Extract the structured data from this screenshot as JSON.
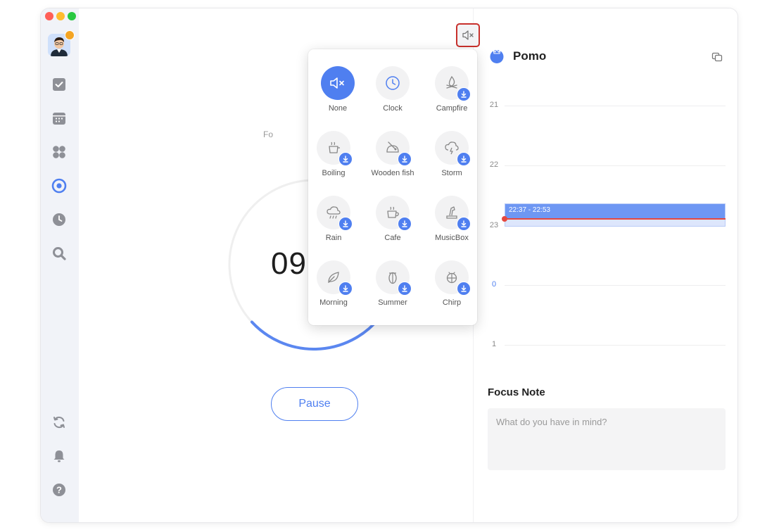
{
  "sidebar": {
    "items": [
      {
        "name": "tasks",
        "icon": "checkbox-icon"
      },
      {
        "name": "calendar",
        "icon": "calendar-icon"
      },
      {
        "name": "matrix",
        "icon": "four-squares-icon"
      },
      {
        "name": "pomodoro",
        "icon": "target-icon"
      },
      {
        "name": "habit",
        "icon": "clock-icon"
      },
      {
        "name": "search",
        "icon": "search-icon"
      }
    ],
    "bottom": [
      {
        "name": "sync",
        "icon": "sync-icon"
      },
      {
        "name": "notifications",
        "icon": "bell-icon"
      },
      {
        "name": "help",
        "icon": "help-icon"
      }
    ]
  },
  "timer": {
    "focus_label_partial": "Fo",
    "display": "09",
    "pause_label": "Pause",
    "progress": 0.27
  },
  "sound_menu": {
    "items": [
      {
        "label": "None",
        "icon": "speaker-muted-icon",
        "active": true,
        "download": false
      },
      {
        "label": "Clock",
        "icon": "clock-icon",
        "active": false,
        "download": false
      },
      {
        "label": "Campfire",
        "icon": "campfire-icon",
        "active": false,
        "download": true
      },
      {
        "label": "Boiling",
        "icon": "kettle-icon",
        "active": false,
        "download": true
      },
      {
        "label": "Wooden fish",
        "icon": "wooden-fish-icon",
        "active": false,
        "download": true
      },
      {
        "label": "Storm",
        "icon": "storm-icon",
        "active": false,
        "download": true
      },
      {
        "label": "Rain",
        "icon": "rain-icon",
        "active": false,
        "download": true
      },
      {
        "label": "Cafe",
        "icon": "coffee-cup-icon",
        "active": false,
        "download": true
      },
      {
        "label": "MusicBox",
        "icon": "music-box-icon",
        "active": false,
        "download": true
      },
      {
        "label": "Morning",
        "icon": "leaf-icon",
        "active": false,
        "download": true
      },
      {
        "label": "Summer",
        "icon": "cicada-icon",
        "active": false,
        "download": true
      },
      {
        "label": "Chirp",
        "icon": "bug-icon",
        "active": false,
        "download": true
      }
    ]
  },
  "right_panel": {
    "title": "Pomo",
    "timeline": {
      "hours": [
        "21",
        "22",
        "23",
        "0",
        "1"
      ],
      "event_time": "22:37 - 22:53"
    },
    "focus_note": {
      "title": "Focus Note",
      "placeholder": "What do you have in mind?"
    }
  },
  "colors": {
    "accent": "#4f7ff0",
    "now_line": "#e5483f",
    "highlight_box": "#c8302c"
  }
}
